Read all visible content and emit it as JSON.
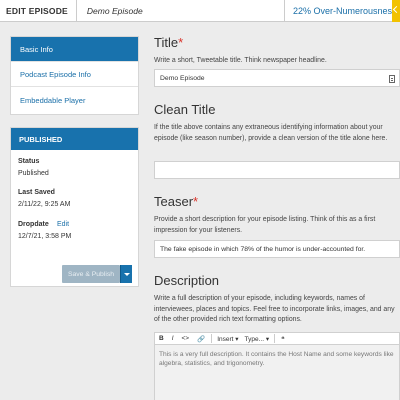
{
  "topbar": {
    "section": "EDIT EPISODE",
    "episode_name": "Demo Episode",
    "show_name": "22% Over-Numerousness"
  },
  "nav": {
    "items": [
      {
        "label": "Basic Info",
        "active": true
      },
      {
        "label": "Podcast Episode Info",
        "active": false
      },
      {
        "label": "Embeddable Player",
        "active": false
      }
    ]
  },
  "published": {
    "header": "PUBLISHED",
    "status_label": "Status",
    "status_value": "Published",
    "last_saved_label": "Last Saved",
    "last_saved_value": "2/11/22, 9:25 AM",
    "dropdate_label": "Dropdate",
    "dropdate_edit": "Edit",
    "dropdate_value": "12/7/21, 3:58 PM",
    "save_button": "Save & Publish"
  },
  "form": {
    "title": {
      "label": "Title",
      "required_mark": "*",
      "help": "Write a short, Tweetable title. Think newspaper headline.",
      "value": "Demo Episode"
    },
    "clean_title": {
      "label": "Clean Title",
      "help": "If the title above contains any extraneous identifying information about your episode (like season number), provide a clean version of the title alone here.",
      "value": ""
    },
    "teaser": {
      "label": "Teaser",
      "required_mark": "*",
      "help": "Provide a short description for your episode listing. Think of this as a first impression for your listeners.",
      "value": "The fake episode in which 78% of the humor is under-accounted for."
    },
    "description": {
      "label": "Description",
      "help": "Write a full description of your episode, including keywords, names of interviewees, places and topics. Feel free to incorporate links, images, and any of the other provided rich text formatting options.",
      "toolbar": {
        "bold": "B",
        "italic": "I",
        "code": "<>",
        "link": "🔗",
        "insert": "Insert ▾",
        "type": "Type... ▾",
        "quote": "❝"
      },
      "value": "This is a very full description. It contains the Host Name and some keywords like algebra, statistics, and trigonometry."
    }
  },
  "colors": {
    "accent": "#1872ad",
    "required": "#d9342b",
    "link": "#1a6fa8",
    "corner_tab": "#f2c200"
  }
}
